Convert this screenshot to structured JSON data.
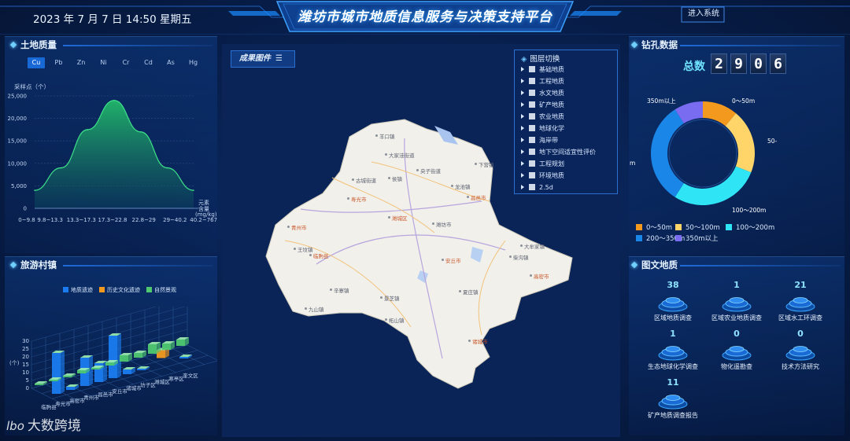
{
  "header": {
    "datetime": "2023 年 7 月 7 日 14:50 星期五",
    "title": "潍坊市城市地质信息服务与决策支持平台",
    "enter_label": "进入系统"
  },
  "soil": {
    "title": "土地质量",
    "elements": [
      "Cu",
      "Pb",
      "Zn",
      "Ni",
      "Cr",
      "Cd",
      "As",
      "Hg"
    ],
    "active": "Cu",
    "y_axis_label": "采样点（个）",
    "unit_label_1": "元素",
    "unit_label_2": "含量",
    "unit_label_3": "(mg/kg)"
  },
  "tour": {
    "title": "旅游村镇",
    "legend": [
      "地质遗迹",
      "历史文化遗迹",
      "自然景观"
    ],
    "y_unit": "(个)"
  },
  "map": {
    "legend_button": "成果图件",
    "layers_title": "图层切换",
    "layers": [
      "基础地质",
      "工程地质",
      "水文地质",
      "矿产地质",
      "农业地质",
      "地球化学",
      "海岸带",
      "地下空间适宜性评价",
      "工程规划",
      "环境地质",
      "2.5d"
    ],
    "places": [
      {
        "name": "羊口镇",
        "red": false
      },
      {
        "name": "大家洼街道",
        "red": false
      },
      {
        "name": "央子街道",
        "red": false
      },
      {
        "name": "下营镇",
        "red": false
      },
      {
        "name": "古城街道",
        "red": false
      },
      {
        "name": "侯镇",
        "red": false
      },
      {
        "name": "寿光市",
        "red": true
      },
      {
        "name": "昌邑市",
        "red": true
      },
      {
        "name": "潍城区",
        "red": true
      },
      {
        "name": "潍坊市",
        "red": false
      },
      {
        "name": "青州市",
        "red": true
      },
      {
        "name": "临朐县",
        "red": true
      },
      {
        "name": "安丘市",
        "red": true
      },
      {
        "name": "高密市",
        "red": true
      },
      {
        "name": "诸城市",
        "red": true
      },
      {
        "name": "王坟镇",
        "red": false
      },
      {
        "name": "辛寨镇",
        "red": false
      },
      {
        "name": "九山镇",
        "red": false
      },
      {
        "name": "柘山镇",
        "red": false
      },
      {
        "name": "景芝镇",
        "red": false
      },
      {
        "name": "夏庄镇",
        "red": false
      },
      {
        "name": "龙池镇",
        "red": false
      },
      {
        "name": "柴沟镇",
        "red": false
      },
      {
        "name": "大牟家镇",
        "red": false
      }
    ]
  },
  "drill": {
    "title": "钻孔数据",
    "total_label": "总数",
    "digits": [
      "2",
      "9",
      "0",
      "6"
    ],
    "legend": [
      {
        "label": "0～50m",
        "color": "#f39a1e"
      },
      {
        "label": "50～100m",
        "color": "#ffd56a"
      },
      {
        "label": "100～200m",
        "color": "#2fe4f4"
      },
      {
        "label": "200～350m",
        "color": "#1a86e8"
      },
      {
        "label": "350m以上",
        "color": "#7a6cf0"
      }
    ],
    "donut_labels": [
      "350m以上",
      "0～50m",
      "50-",
      "100～200m",
      "m"
    ]
  },
  "reports": {
    "title": "图文地质",
    "items": [
      {
        "num": "38",
        "label": "区域地质调查"
      },
      {
        "num": "1",
        "label": "区域农业地质调查"
      },
      {
        "num": "21",
        "label": "区域水工环调查"
      },
      {
        "num": "1",
        "label": "生态地球化学调查"
      },
      {
        "num": "0",
        "label": "物化遥勘查"
      },
      {
        "num": "0",
        "label": "技术方法研究"
      },
      {
        "num": "11",
        "label": "矿产地质调查报告"
      }
    ]
  },
  "watermark": {
    "logo": "lbo",
    "text": "大数跨境"
  },
  "chart_data": [
    {
      "type": "area",
      "title": "",
      "ylabel": "采样点（个）",
      "xlabel": "元素含量(mg/kg)",
      "categories": [
        "0~9.8",
        "9.8~13.3",
        "13.3~17.3",
        "17.3~22.8",
        "22.8~29",
        "29~40.2",
        "40.2~767.5"
      ],
      "ylim": [
        0,
        25000
      ],
      "yticks": [
        "0",
        "5,000",
        "10,000",
        "15,000",
        "20,000",
        "25,000"
      ],
      "values": [
        4000,
        9000,
        17500,
        24000,
        17000,
        9000,
        4000
      ]
    },
    {
      "type": "bar",
      "title": "",
      "ylabel": "(个)",
      "ylim": [
        0,
        30
      ],
      "yticks": [
        "0",
        "5",
        "10",
        "15",
        "20",
        "25",
        "30"
      ],
      "categories": [
        "临朐县",
        "寿光市",
        "高密市",
        "青州市",
        "昌邑市",
        "安丘市",
        "诸城市",
        "坊子区",
        "潍城区",
        "寒亭区",
        "奎文区"
      ],
      "series": [
        {
          "name": "地质遗迹",
          "values": [
            26,
            2,
            18,
            12,
            27,
            3,
            1,
            0,
            0,
            1,
            0
          ]
        },
        {
          "name": "历史文化遗迹",
          "values": [
            0,
            0,
            0,
            0,
            0,
            0,
            0,
            0,
            5,
            0,
            0
          ]
        },
        {
          "name": "自然景观",
          "values": [
            1,
            1,
            1,
            2,
            1,
            2,
            4,
            3,
            6,
            4,
            4
          ]
        }
      ],
      "colors": [
        "#1a7cf0",
        "#f39a1e",
        "#4fc870"
      ]
    },
    {
      "type": "pie",
      "title": "钻孔数据",
      "categories": [
        "0～50m",
        "50～100m",
        "100～200m",
        "200～350m",
        "350m以上"
      ],
      "values": [
        11,
        20,
        28,
        32,
        9
      ],
      "colors": [
        "#f39a1e",
        "#ffd56a",
        "#2fe4f4",
        "#1a86e8",
        "#7a6cf0"
      ]
    }
  ]
}
